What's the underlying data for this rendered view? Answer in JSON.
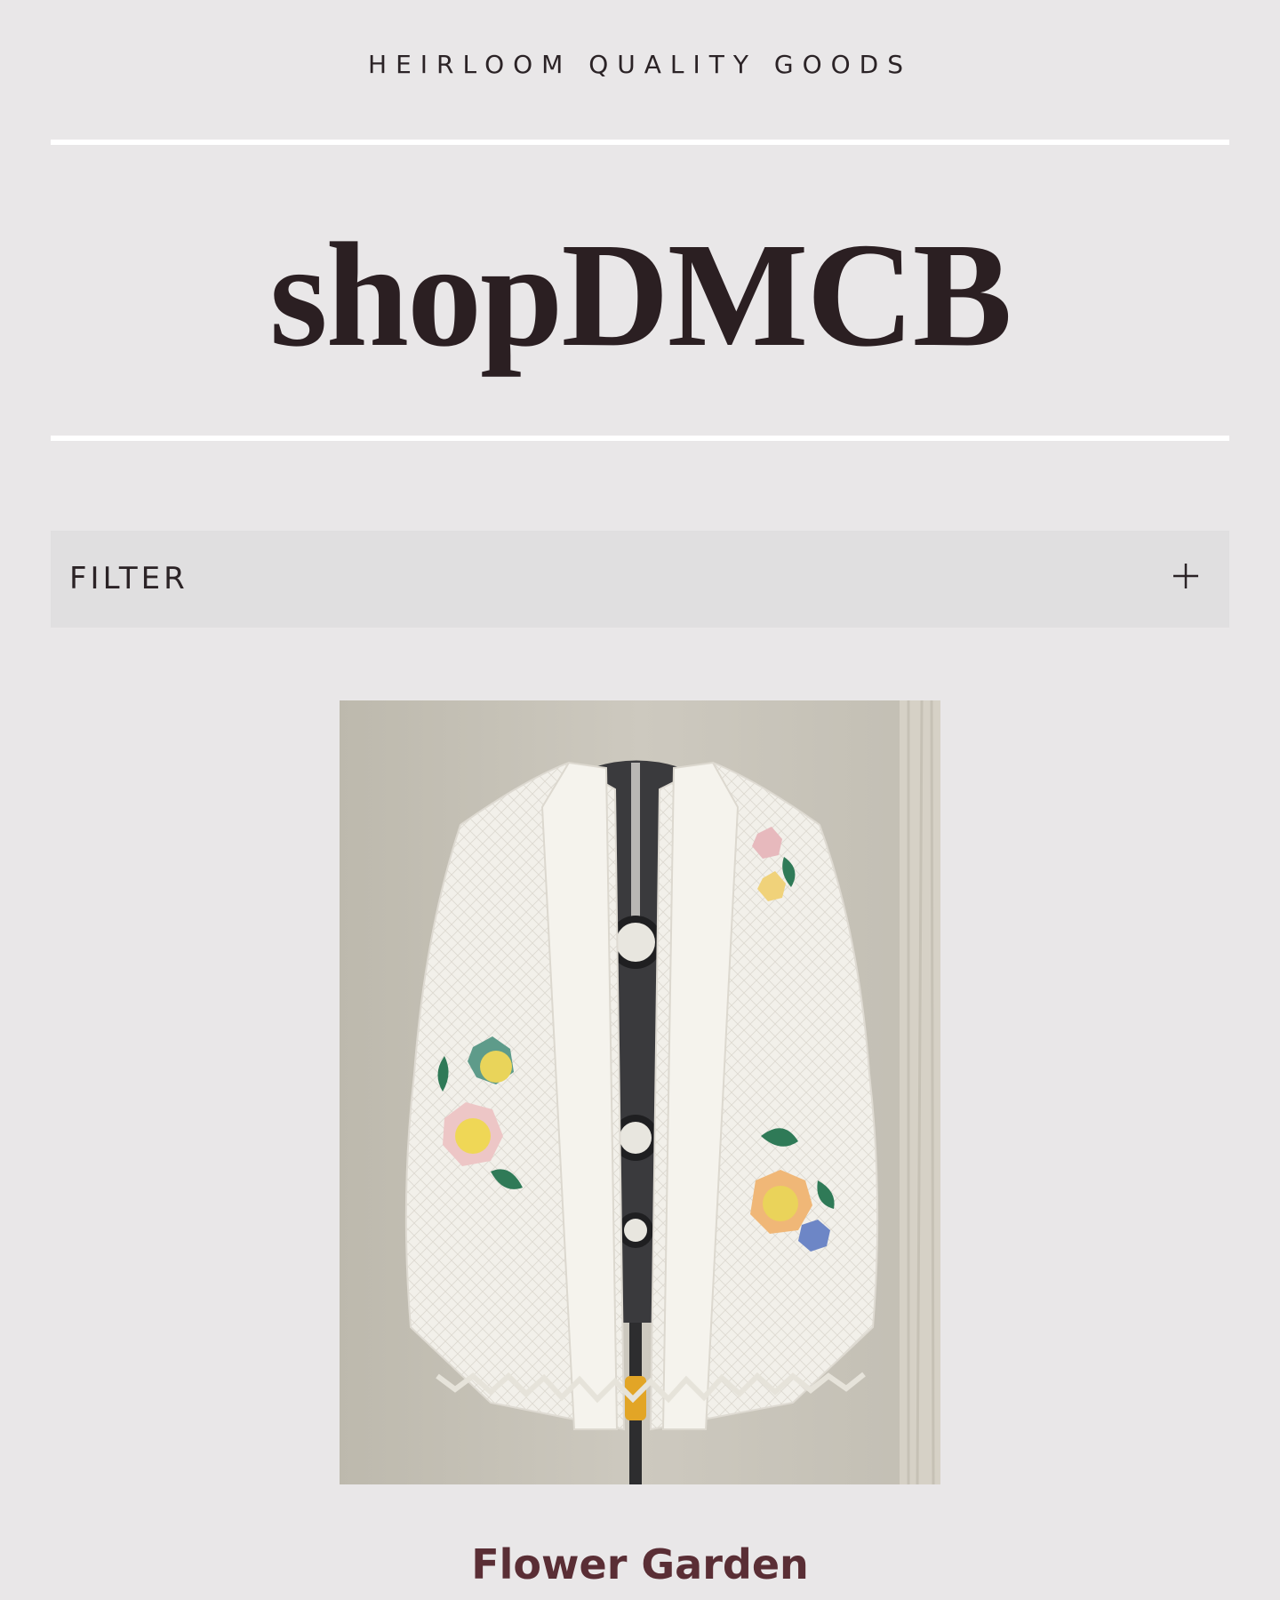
{
  "header": {
    "tagline": "HEIRLOOM QUALITY GOODS",
    "brand": "shopDMCB"
  },
  "filter": {
    "label": "FILTER",
    "icon": "plus-icon"
  },
  "products": [
    {
      "title": "Flower Garden",
      "image_icon": "quilt-jacket-image"
    }
  ],
  "colors": {
    "background": "#e9e7e8",
    "filter_bar": "#e0dfe0",
    "divider": "#ffffff",
    "product_title": "#5a2e35"
  }
}
